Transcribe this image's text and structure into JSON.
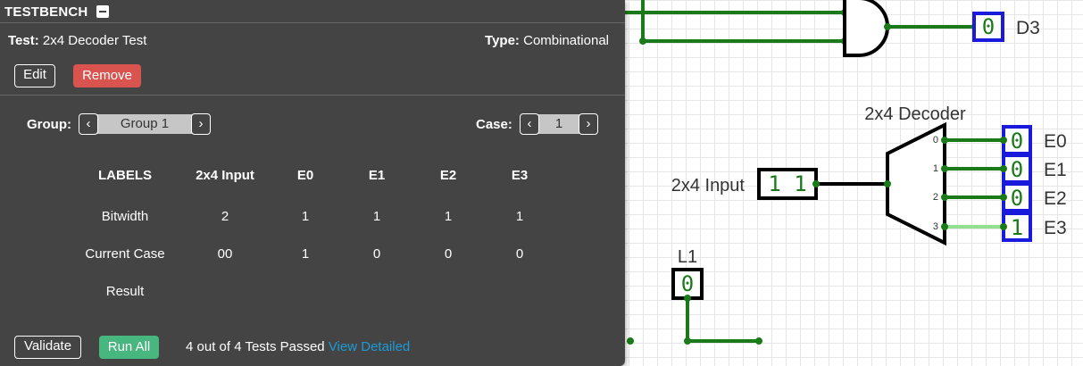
{
  "testbench": {
    "title": "TESTBENCH",
    "test_label": "Test:",
    "test_name": "2x4 Decoder Test",
    "type_label": "Type:",
    "type_value": "Combinational",
    "edit_label": "Edit",
    "remove_label": "Remove",
    "group_label": "Group:",
    "group_value": "Group 1",
    "case_label": "Case:",
    "case_value": "1",
    "prev_glyph": "‹",
    "next_glyph": "›",
    "table": {
      "headers": [
        "LABELS",
        "2x4 Input",
        "E0",
        "E1",
        "E2",
        "E3"
      ],
      "rows": [
        {
          "label": "Bitwidth",
          "values": [
            "2",
            "1",
            "1",
            "1",
            "1"
          ]
        },
        {
          "label": "Current Case",
          "values": [
            "00",
            "1",
            "0",
            "0",
            "0"
          ]
        },
        {
          "label": "Result",
          "values": [
            "",
            "",
            "",
            "",
            ""
          ]
        }
      ]
    },
    "validate_label": "Validate",
    "run_all_label": "Run All",
    "status_text": "4 out of 4 Tests Passed",
    "view_detailed_label": "View Detailed"
  },
  "circuit": {
    "d3_value": "0",
    "d3_label": "D3",
    "decoder_label": "2x4 Decoder",
    "input_label": "2x4 Input",
    "input_value": "1 1",
    "port_labels": [
      "0",
      "1",
      "2",
      "3"
    ],
    "outputs": [
      {
        "label": "E0",
        "value": "0"
      },
      {
        "label": "E1",
        "value": "0"
      },
      {
        "label": "E2",
        "value": "0"
      },
      {
        "label": "E3",
        "value": "1"
      }
    ],
    "l1_label": "L1",
    "l1_value": "0"
  },
  "colors": {
    "panel": "#444444",
    "wire": "#1a7a1a",
    "wire_high": "#90e090",
    "output_border": "#1a1adc",
    "remove": "#d9534f",
    "run_all": "#48b67f",
    "link": "#1d9bd6"
  }
}
